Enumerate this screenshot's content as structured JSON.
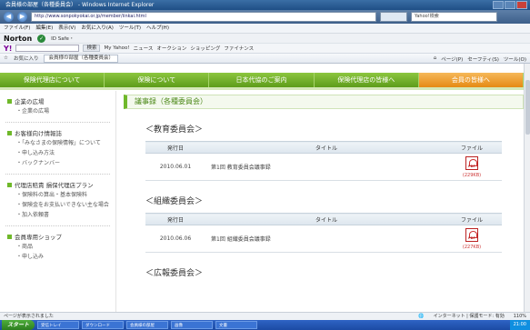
{
  "browser": {
    "title": "会員様の部屋（各種委員会） - Windows Internet Explorer",
    "url": "http://www.sonpokyokai.or.jp/member/iinkai.html",
    "search_placeholder": "Yahoo!検索",
    "menu": [
      "ファイル(F)",
      "編集(E)",
      "表示(V)",
      "お気に入り(A)",
      "ツール(T)",
      "ヘルプ(H)"
    ],
    "norton": {
      "logo": "Norton",
      "label": "ID Safe・"
    },
    "yahoo": {
      "logo": "Y!",
      "items": [
        "検索",
        "My Yahoo!",
        "ニュース",
        "オークション",
        "ショッピング",
        "ファイナンス"
      ]
    },
    "favorites": {
      "label": "お気に入り",
      "tab": "会員様の部屋（各種委員会）",
      "tools": [
        "ページ(P)",
        "セーフティ(S)",
        "ツール(O)"
      ]
    },
    "status": {
      "left": "ページが表示されました",
      "zone": "インターネット | 保護モード: 有効",
      "zoom": "110%"
    },
    "taskbar": {
      "start": "スタート",
      "items": [
        "受信トレイ",
        "ダウンロード",
        "会員様の部屋",
        "画像",
        "文書"
      ],
      "clock": "21:00"
    }
  },
  "site_nav": [
    {
      "label": "保険代理店について"
    },
    {
      "label": "保険について"
    },
    {
      "label": "日本代協のご案内"
    },
    {
      "label": "保険代理店の皆様へ"
    },
    {
      "label": "会員の皆様へ",
      "active": true
    }
  ],
  "sidebar": {
    "groups": [
      {
        "title": "企業の広場",
        "links": [
          "企業の広場"
        ]
      },
      {
        "title": "お客様向け情報誌",
        "links": [
          "「みなさまの保険情報」について",
          "申し込み方法",
          "バックナンバー"
        ]
      },
      {
        "title": "代理店賠責 損保代理店プラン",
        "links": [
          "保険料の算出・基本保険料",
          "保険金をお支払いできない主な場合",
          "加入依頼書"
        ]
      },
      {
        "title": "会員専用ショップ",
        "links": [
          "商品",
          "申し込み"
        ]
      }
    ]
  },
  "main": {
    "title": "議事録（各種委員会）",
    "columns": {
      "date": "発行日",
      "title": "タイトル",
      "file": "ファイル"
    },
    "sections": [
      {
        "heading": "＜教育委員会＞",
        "rows": [
          {
            "date": "2010.06.01",
            "title": "第1回 教育委員会議事録",
            "size": "(229KB)"
          }
        ]
      },
      {
        "heading": "＜組織委員会＞",
        "rows": [
          {
            "date": "2010.06.06",
            "title": "第1回 組織委員会議事録",
            "size": "(227KB)"
          }
        ]
      },
      {
        "heading": "＜広報委員会＞",
        "rows": []
      }
    ]
  }
}
